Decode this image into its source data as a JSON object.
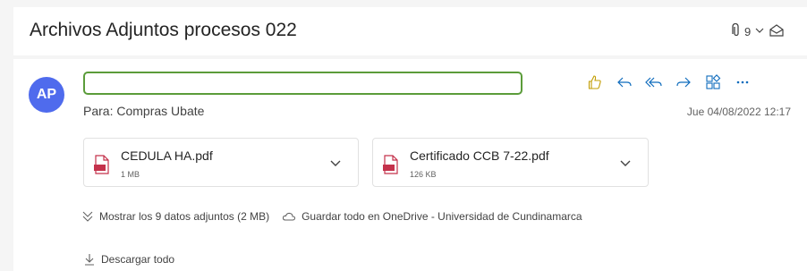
{
  "subject": "Archivos Adjuntos procesos 022",
  "attachment_count": "9",
  "avatar_initials": "AP",
  "to_label": "Para:",
  "to_name": "Compras Ubate",
  "date": "Jue 04/08/2022 12:17",
  "attachments": [
    {
      "name": "CEDULA HA.pdf",
      "size": "1 MB"
    },
    {
      "name": "Certificado CCB 7-22.pdf",
      "size": "126 KB"
    }
  ],
  "show_all": "Mostrar los 9 datos adjuntos (2 MB)",
  "save_onedrive": "Guardar todo en OneDrive - Universidad de Cundinamarca",
  "download_all": "Descargar todo",
  "colors": {
    "avatar": "#4f6bed",
    "sender_outline": "#5b9c3a",
    "pdf": "#c4314b"
  },
  "icons": [
    "paperclip-icon",
    "chevron-down-icon",
    "envelope-open-icon",
    "like-icon",
    "reply-icon",
    "reply-all-icon",
    "forward-icon",
    "apps-icon",
    "more-icon",
    "pdf-icon",
    "cloud-icon",
    "download-icon"
  ]
}
